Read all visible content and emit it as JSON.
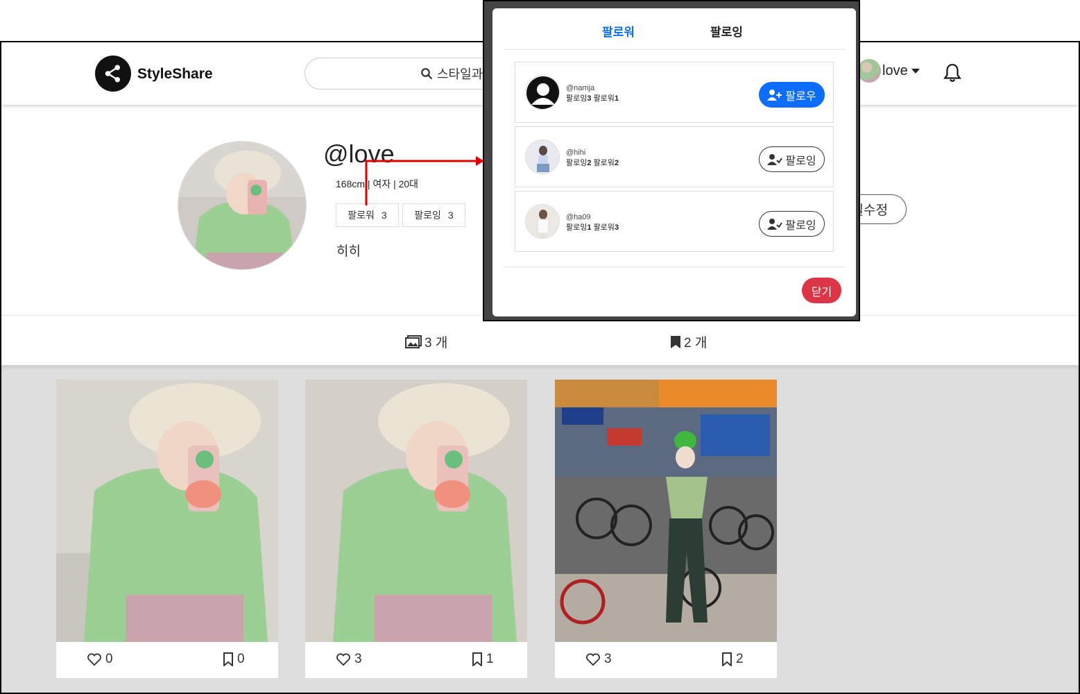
{
  "nav": {
    "brand": "StyleShare",
    "search_text": "스타일과",
    "username": "love"
  },
  "profile": {
    "handle": "@love",
    "meta": "168cm | 여자 | 20대",
    "followers_label": "팔로워",
    "followers_count": "3",
    "following_label": "팔로잉",
    "following_count": "3",
    "bio": "히히",
    "edit_label": "필수정"
  },
  "counts": {
    "posts": "3 개",
    "bookmarks": "2 개"
  },
  "posts": [
    {
      "likes": "0",
      "bookmarks": "0"
    },
    {
      "likes": "3",
      "bookmarks": "1"
    },
    {
      "likes": "3",
      "bookmarks": "2"
    }
  ],
  "modal": {
    "tab_followers": "팔로워",
    "tab_following": "팔로잉",
    "close_label": "닫기",
    "users": [
      {
        "handle": "@namja",
        "following_label": "팔로잉",
        "following": "3",
        "followers_label": "팔로워",
        "followers": "1",
        "button": "팔로우",
        "button_style": "primary"
      },
      {
        "handle": "@hihi",
        "following_label": "팔로잉",
        "following": "2",
        "followers_label": "팔로워",
        "followers": "2",
        "button": "팔로잉",
        "button_style": "outline"
      },
      {
        "handle": "@ha09",
        "following_label": "팔로잉",
        "following": "1",
        "followers_label": "팔로워",
        "followers": "3",
        "button": "팔로잉",
        "button_style": "outline"
      }
    ]
  },
  "colors": {
    "accent_blue": "#0d6efd",
    "danger_red": "#dc3545",
    "annotation_arrow": "#e00000"
  }
}
